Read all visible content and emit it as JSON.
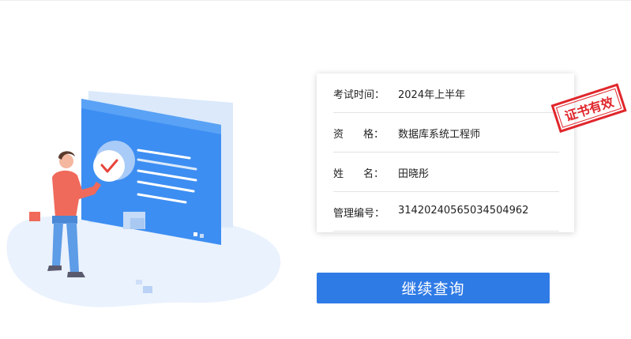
{
  "card": {
    "rows": [
      {
        "label": "考试时间：",
        "value": "2024年上半年"
      },
      {
        "label_chars": [
          "资",
          "格："
        ],
        "value": "数据库系统工程师"
      },
      {
        "label_chars": [
          "姓",
          "名："
        ],
        "value": "田晓彤"
      },
      {
        "label": "管理编号：",
        "value": "31420240565034504962"
      }
    ]
  },
  "stamp": {
    "text": "证书有效"
  },
  "button": {
    "label": "继续查询"
  },
  "colors": {
    "primary": "#2f7be6",
    "stamp_red": "#e0262b"
  }
}
